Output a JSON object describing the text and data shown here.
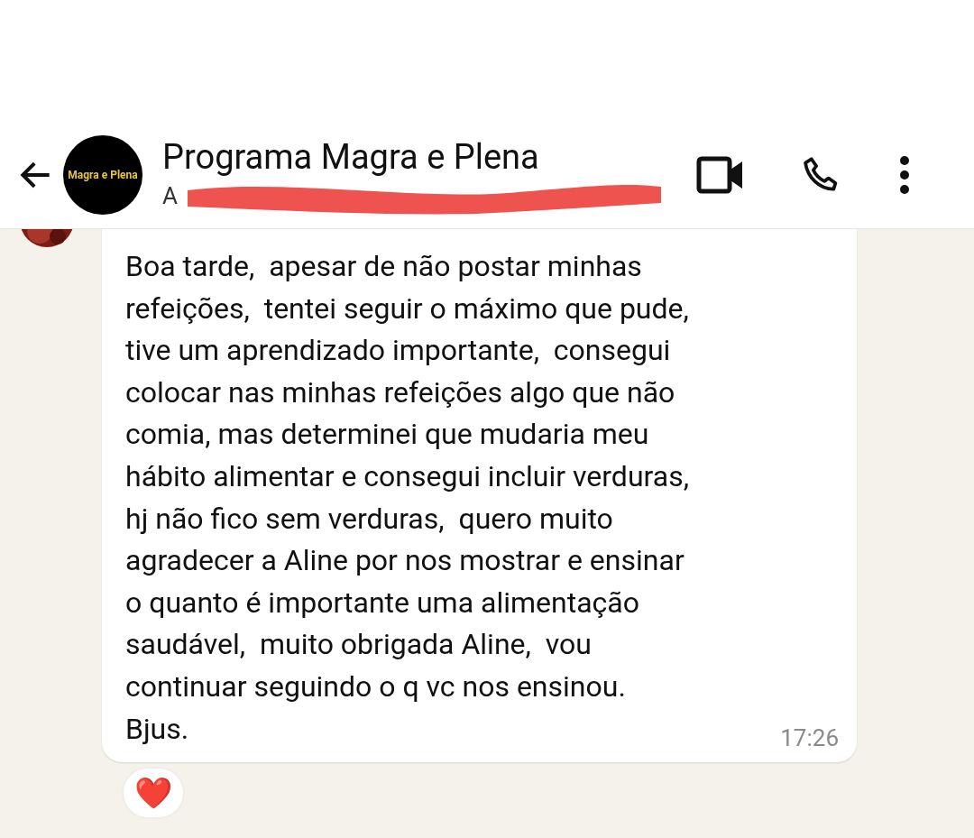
{
  "header": {
    "avatar_text": "Magra e Plena",
    "title": "Programa Magra e Plena",
    "subtitle": "A"
  },
  "message": {
    "text": "Boa tarde,  apesar de não postar minhas\nrefeições,  tentei seguir o máximo que pude,\ntive um aprendizado importante,  consegui\ncolocar nas minhas refeições algo que não\ncomia, mas determinei que mudaria meu\nhábito alimentar e consegui incluir verduras,\nhj não fico sem verduras,  quero muito\nagradecer a Aline por nos mostrar e ensinar\no quanto é importante uma alimentação\nsaudável,  muito obrigada Aline,  vou\ncontinuar seguindo o q vc nos ensinou.\nBjus.",
    "time": "17:26",
    "reaction": "❤️"
  }
}
